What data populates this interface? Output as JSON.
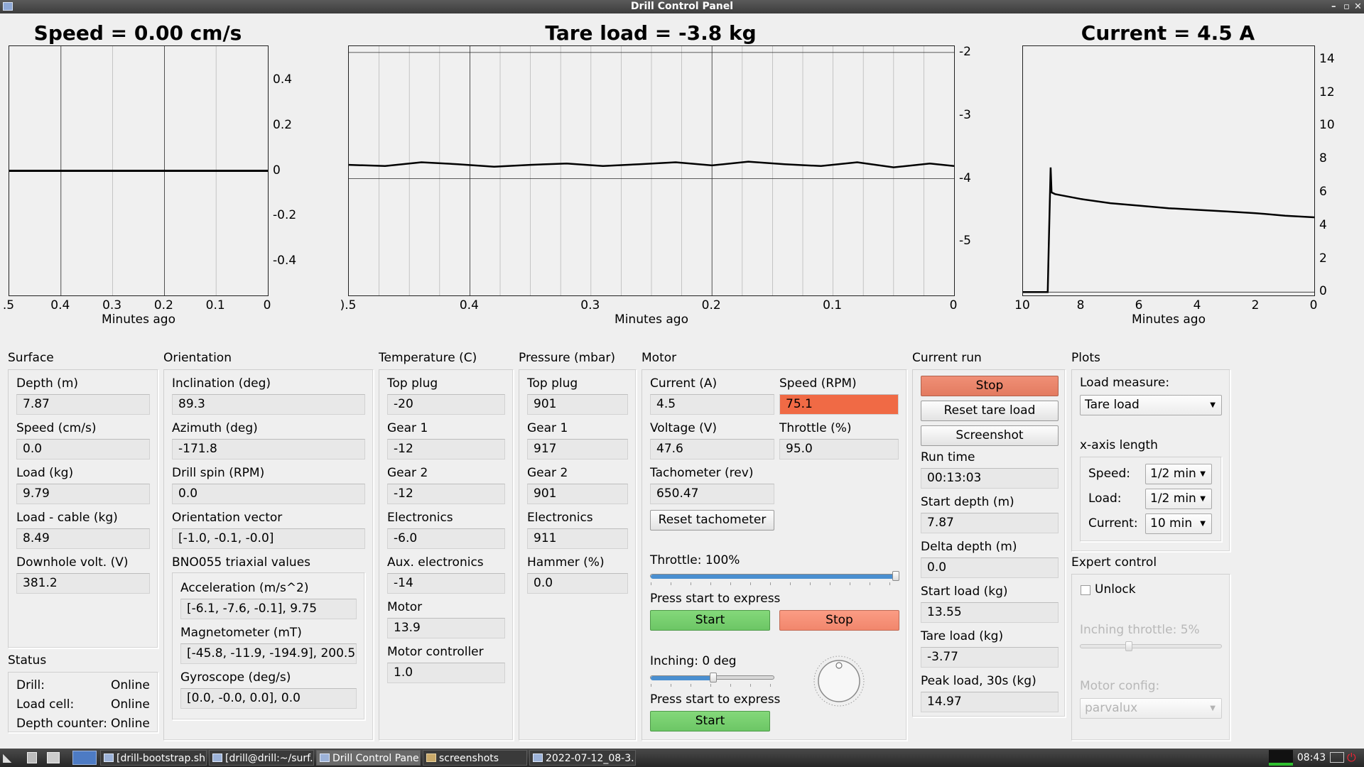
{
  "window": {
    "title": "Drill Control Panel"
  },
  "plots": {
    "speed": {
      "title": "Speed = 0.00 cm/s",
      "xlabel": "Minutes ago",
      "xticks": [
        ".5",
        "0.4",
        "0.3",
        "0.2",
        "0.1",
        "0"
      ],
      "yticks": [
        "0.4",
        "0.2",
        "0",
        "-0.2",
        "-0.4"
      ]
    },
    "load": {
      "title": "Tare load = -3.8 kg",
      "xlabel": "Minutes ago",
      "xticks": [
        ").5",
        "0.4",
        "0.3",
        "0.2",
        "0.1",
        "0"
      ],
      "yticks": [
        "-2",
        "-3",
        "-4",
        "-5"
      ]
    },
    "current": {
      "title": "Current = 4.5 A",
      "xlabel": "Minutes ago",
      "xticks": [
        "10",
        "8",
        "6",
        "4",
        "2",
        "0"
      ],
      "yticks": [
        "14",
        "12",
        "10",
        "8",
        "6",
        "4",
        "2",
        "0"
      ]
    }
  },
  "chart_data": [
    {
      "type": "line",
      "title": "Speed = 0.00 cm/s",
      "xlabel": "Minutes ago",
      "ylabel": "",
      "xlim": [
        0.5,
        0
      ],
      "ylim": [
        -0.55,
        0.55
      ],
      "x": [
        0.5,
        0.0
      ],
      "y": [
        0.0,
        0.0
      ]
    },
    {
      "type": "line",
      "title": "Tare load = -3.8 kg",
      "xlabel": "Minutes ago",
      "ylabel": "",
      "xlim": [
        0.5,
        0
      ],
      "ylim": [
        -5.85,
        -1.9
      ],
      "x": [
        0.5,
        0.47,
        0.44,
        0.41,
        0.38,
        0.35,
        0.32,
        0.29,
        0.26,
        0.23,
        0.2,
        0.17,
        0.14,
        0.11,
        0.08,
        0.05,
        0.02,
        0.0
      ],
      "y": [
        -3.78,
        -3.8,
        -3.74,
        -3.77,
        -3.81,
        -3.78,
        -3.76,
        -3.8,
        -3.77,
        -3.74,
        -3.79,
        -3.73,
        -3.77,
        -3.8,
        -3.74,
        -3.82,
        -3.76,
        -3.8
      ]
    },
    {
      "type": "line",
      "title": "Current = 4.5 A",
      "xlabel": "Minutes ago",
      "ylabel": "",
      "xlim": [
        10,
        0
      ],
      "ylim": [
        -0.2,
        14.8
      ],
      "x": [
        10,
        9.15,
        9.12,
        9.05,
        9.02,
        8.9,
        8,
        7,
        6,
        5,
        4,
        3,
        2,
        1,
        0
      ],
      "y": [
        0,
        0,
        2.5,
        7.5,
        6,
        5.9,
        5.6,
        5.35,
        5.2,
        5.05,
        4.95,
        4.85,
        4.75,
        4.6,
        4.5
      ]
    }
  ],
  "surface": {
    "title": "Surface",
    "depth_label": "Depth (m)",
    "depth": "7.87",
    "speed_label": "Speed (cm/s)",
    "speed": "0.0",
    "load_label": "Load (kg)",
    "load": "9.79",
    "load_cable_label": "Load - cable (kg)",
    "load_cable": "8.49",
    "volt_label": "Downhole volt. (V)",
    "volt": "381.2"
  },
  "status": {
    "title": "Status",
    "rows": [
      {
        "label": "Drill:",
        "value": "Online"
      },
      {
        "label": "Load cell:",
        "value": "Online"
      },
      {
        "label": "Depth counter:",
        "value": "Online"
      }
    ]
  },
  "orientation": {
    "title": "Orientation",
    "inclination_label": "Inclination (deg)",
    "inclination": "89.3",
    "azimuth_label": "Azimuth (deg)",
    "azimuth": "-171.8",
    "spin_label": "Drill spin (RPM)",
    "spin": "0.0",
    "vector_label": "Orientation vector",
    "vector": "[-1.0, -0.1, -0.0]",
    "bno_label": "BNO055 triaxial values",
    "accel_label": "Acceleration (m/s^2)",
    "accel": "[-6.1, -7.6, -0.1], 9.75",
    "mag_label": "Magnetometer (mT)",
    "mag": "[-45.8, -11.9, -194.9], 200.5",
    "gyro_label": "Gyroscope (deg/s)",
    "gyro": "[0.0, -0.0, 0.0], 0.0"
  },
  "temperature": {
    "title": "Temperature (C)",
    "items": [
      {
        "label": "Top plug",
        "value": "-20"
      },
      {
        "label": "Gear 1",
        "value": "-12"
      },
      {
        "label": "Gear 2",
        "value": "-12"
      },
      {
        "label": "Electronics",
        "value": "-6.0"
      },
      {
        "label": "Aux. electronics",
        "value": "-14"
      },
      {
        "label": "Motor",
        "value": "13.9"
      },
      {
        "label": "Motor controller",
        "value": "1.0"
      }
    ]
  },
  "pressure": {
    "title": "Pressure (mbar)",
    "items": [
      {
        "label": "Top plug",
        "value": "901"
      },
      {
        "label": "Gear 1",
        "value": "917"
      },
      {
        "label": "Gear 2",
        "value": "901"
      },
      {
        "label": "Electronics",
        "value": "911"
      },
      {
        "label": "Hammer (%)",
        "value": "0.0"
      }
    ]
  },
  "motor": {
    "title": "Motor",
    "current_label": "Current (A)",
    "current": "4.5",
    "rpm_label": "Speed (RPM)",
    "rpm": "75.1",
    "voltage_label": "Voltage (V)",
    "voltage": "47.6",
    "throttle_pct_label": "Throttle (%)",
    "throttle_pct": "95.0",
    "tacho_label": "Tachometer (rev)",
    "tacho": "650.47",
    "reset_tacho": "Reset tachometer",
    "throttle_label": "Throttle: 100%",
    "throttle_level": 1.0,
    "express1": "Press start to express",
    "start": "Start",
    "stop": "Stop",
    "inching_label": "Inching: 0 deg",
    "inching_level": 0.5,
    "express2": "Press start to express",
    "start2": "Start"
  },
  "run": {
    "title": "Current run",
    "stop": "Stop",
    "reset_tare": "Reset tare load",
    "screenshot": "Screenshot",
    "runtime_label": "Run time",
    "runtime": "00:13:03",
    "start_depth_label": "Start depth (m)",
    "start_depth": "7.87",
    "delta_depth_label": "Delta depth (m)",
    "delta_depth": "0.0",
    "start_load_label": "Start load (kg)",
    "start_load": "13.55",
    "tare_label": "Tare load (kg)",
    "tare": "-3.77",
    "peak_label": "Peak load, 30s (kg)",
    "peak": "14.97"
  },
  "plots_panel": {
    "title": "Plots",
    "load_measure_label": "Load measure:",
    "load_measure": "Tare load",
    "xaxis_label": "x-axis length",
    "speed_label": "Speed:",
    "speed": "1/2 min",
    "load_label": "Load:",
    "load": "1/2 min",
    "current_label": "Current:",
    "current": "10 min"
  },
  "expert": {
    "title": "Expert control",
    "unlock": "Unlock",
    "inching_throttle": "Inching throttle: 5%",
    "inching_throttle_level": 0.33,
    "motor_config_label": "Motor config:",
    "motor_config": "parvalux"
  },
  "taskbar": {
    "tasks": [
      "[drill-bootstrap.sh]",
      "[drill@drill:~/surf...",
      "Drill Control Panel",
      "screenshots",
      "2022-07-12_08-3..."
    ],
    "clock": "08:43"
  },
  "colors": {
    "plot_line": "#000000",
    "stop_red": "#e37b60",
    "start_green": "#6cc665",
    "rpm_warn": "#f06a45",
    "slider_blue": "#4a8fd0"
  }
}
